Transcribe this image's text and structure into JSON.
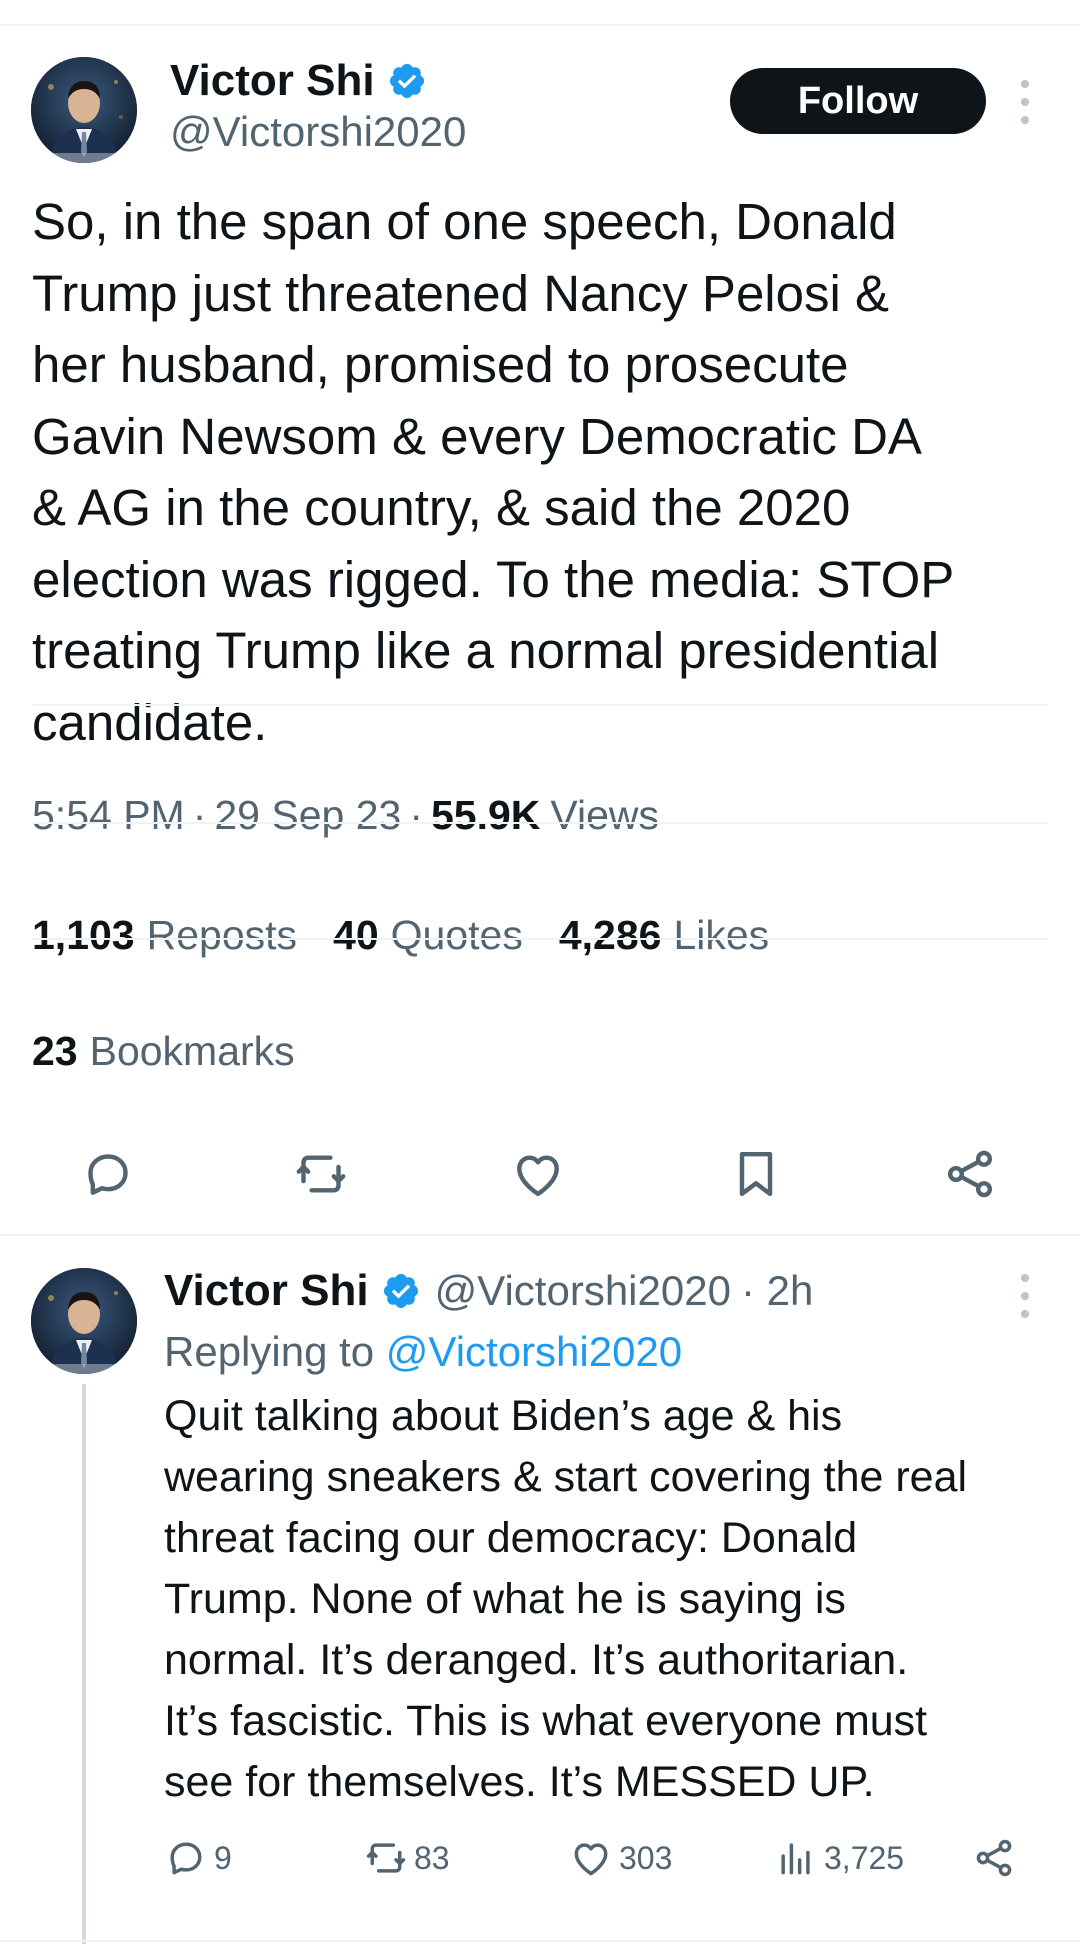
{
  "main_tweet": {
    "author": {
      "display_name": "Victor Shi",
      "handle": "@Victorshi2020",
      "verified": true
    },
    "follow_label": "Follow",
    "text": "So, in the span of one speech, Donald\nTrump just threatened Nancy Pelosi &\nher husband, promised to prosecute\nGavin Newsom & every Democratic DA\n& AG in the country, & said the 2020\nelection was rigged. To the media: STOP\ntreating Trump like a normal presidential\ncandidate.",
    "time": "5:54 PM",
    "date": "29 Sep 23",
    "views_count": "55.9K",
    "views_label": "Views",
    "separator": "·",
    "stats": {
      "reposts_count": "1,103",
      "reposts_label": "Reposts",
      "quotes_count": "40",
      "quotes_label": "Quotes",
      "likes_count": "4,286",
      "likes_label": "Likes",
      "bookmarks_count": "23",
      "bookmarks_label": "Bookmarks"
    },
    "actions": [
      "reply-icon",
      "repost-icon",
      "like-icon",
      "bookmark-icon",
      "share-icon"
    ]
  },
  "reply": {
    "author": {
      "display_name": "Victor Shi",
      "handle": "@Victorshi2020",
      "verified": true
    },
    "time": "· 2h",
    "replying_prefix": "Replying to",
    "replying_to": "@Victorshi2020",
    "text": "Quit talking about Biden’s age & his\nwearing sneakers & start covering the real\nthreat facing our democracy: Donald\nTrump. None of what he is saying is\nnormal. It’s deranged. It’s authoritarian.\nIt’s fascistic. This is what everyone must\nsee for themselves. It’s MESSED UP.",
    "counts": {
      "replies": "9",
      "reposts": "83",
      "likes": "303",
      "views": "3,725"
    }
  },
  "colors": {
    "text_primary": "#0f1419",
    "text_secondary": "#536471",
    "accent_blue": "#1d9bf0",
    "divider": "#eff3f4",
    "follow_bg": "#0f1419"
  }
}
